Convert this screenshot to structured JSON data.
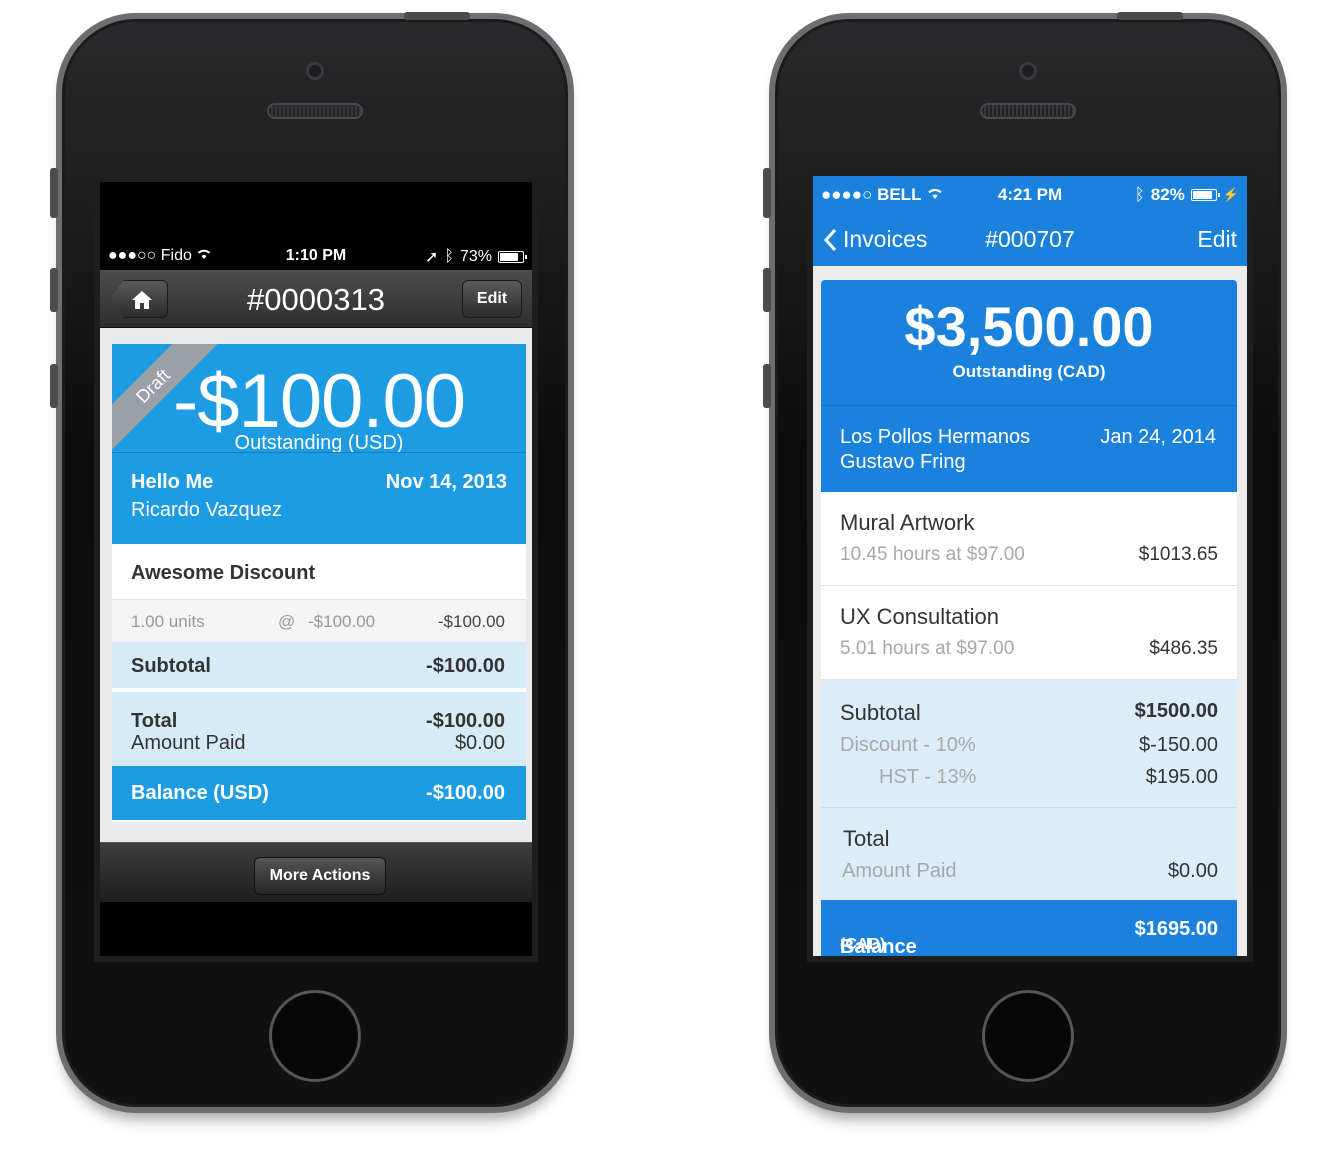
{
  "left_phone": {
    "status": {
      "carrier": "●●●○○ Fido",
      "time": "1:10 PM",
      "battery": "73%",
      "battery_level": 0.73
    },
    "nav": {
      "title": "#0000313",
      "edit_label": "Edit",
      "home_icon": "home-icon"
    },
    "hero": {
      "ribbon": "Draft",
      "amount": "-$100.00",
      "outstanding": "Outstanding (USD)"
    },
    "client": {
      "name": "Hello Me",
      "contact": "Ricardo Vazquez",
      "date": "Nov 14, 2013"
    },
    "item": {
      "title": "Awesome Discount",
      "units": "1.00 units",
      "at": "@",
      "rate": "-$100.00",
      "amount": "-$100.00"
    },
    "subtotal": {
      "label": "Subtotal",
      "value": "-$100.00"
    },
    "total": {
      "label": "Total",
      "value": "-$100.00",
      "paid_label": "Amount Paid",
      "paid_value": "$0.00"
    },
    "balance": {
      "label": "Balance (USD)",
      "value": "-$100.00"
    },
    "toolbar": {
      "more_actions": "More Actions"
    }
  },
  "right_phone": {
    "status": {
      "carrier": "●●●●○ BELL",
      "time": "4:21 PM",
      "battery": "82%",
      "battery_level": 0.82
    },
    "nav": {
      "back_label": "Invoices",
      "title": "#000707",
      "edit_label": "Edit"
    },
    "hero": {
      "amount": "$3,500.00",
      "outstanding": "Outstanding (CAD)"
    },
    "client": {
      "company": "Los Pollos Hermanos",
      "contact": "Gustavo Fring",
      "date": "Jan 24, 2014"
    },
    "items": [
      {
        "title": "Mural Artwork",
        "detail": "10.45 hours at $97.00",
        "amount": "$1013.65"
      },
      {
        "title": "UX Consultation",
        "detail": "5.01 hours at $97.00",
        "amount": "$486.35"
      }
    ],
    "summary": {
      "subtotal_label": "Subtotal",
      "subtotal_value": "$1500.00",
      "discount_label": "Discount - 10%",
      "discount_value": "$-150.00",
      "tax_label": "HST - 13%",
      "tax_value": "$195.00"
    },
    "total": {
      "label": "Total",
      "paid_label": "Amount Paid",
      "paid_value": "$0.00"
    },
    "balance": {
      "label": "Balance",
      "currency": "(CAD)",
      "value": "$1695.00"
    }
  },
  "colors": {
    "left_accent": "#1d9be3",
    "right_accent": "#1a82dc",
    "summary_bg": "#dcedf8"
  }
}
